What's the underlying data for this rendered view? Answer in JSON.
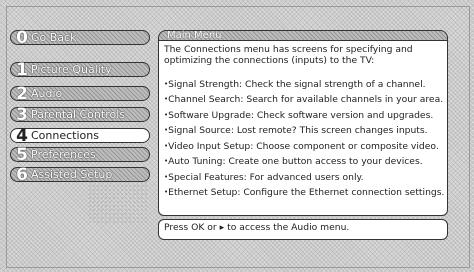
{
  "menu": {
    "items": [
      {
        "num": "0",
        "label": "Go Back"
      },
      {
        "num": "1",
        "label": "Picture Quality"
      },
      {
        "num": "2",
        "label": "Audio"
      },
      {
        "num": "3",
        "label": "Parental Controls"
      },
      {
        "num": "4",
        "label": "Connections"
      },
      {
        "num": "5",
        "label": "Preferences"
      },
      {
        "num": "6",
        "label": "Assisted Setup"
      }
    ],
    "selected": "Connections"
  },
  "panel": {
    "title": "Main Menu",
    "intro": "The Connections menu has screens for specifying and optimizing the connections (inputs) to the TV:",
    "bullet": "•",
    "features": [
      "Signal Strength: Check the signal strength of a channel.",
      "Channel Search: Search for available channels in your area.",
      "Software Upgrade: Check software version and upgrades.",
      "Signal Source: Lost remote? This screen changes inputs.",
      "Video Input Setup: Choose component or composite video.",
      "Auto Tuning: Create one button access to your devices.",
      "Special Features: For advanced users only.",
      "Ethernet Setup: Configure the Ethernet connection settings."
    ],
    "hint": "Press OK or ▸ to access the Audio menu."
  }
}
